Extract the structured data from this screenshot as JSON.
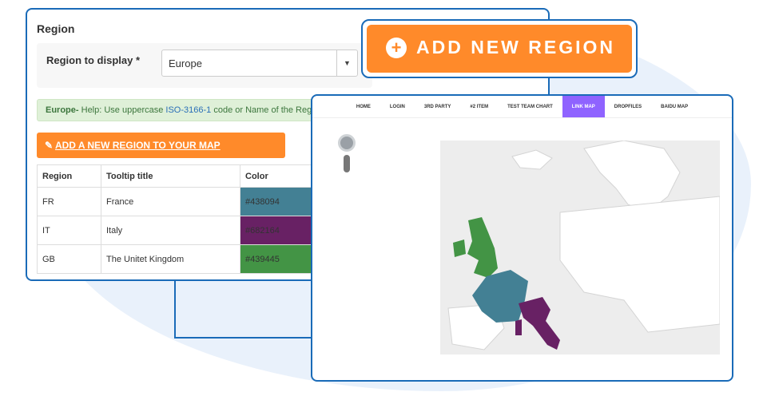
{
  "admin": {
    "title": "Region",
    "region_label": "Region to display *",
    "region_value": "Europe",
    "help_region": "Europe-",
    "help_text": " Help: Use uppercase ",
    "help_link": "ISO-3166-1",
    "help_tail": " code or Name of the Regio",
    "add_link": "ADD A NEW REGION TO YOUR MAP",
    "table": {
      "headers": [
        "Region",
        "Tooltip title",
        "Color"
      ],
      "rows": [
        {
          "region": "FR",
          "title": "France",
          "color": "#438094"
        },
        {
          "region": "IT",
          "title": "Italy",
          "color": "#682164"
        },
        {
          "region": "GB",
          "title": "The Unitet Kingdom",
          "color": "#439445"
        }
      ]
    }
  },
  "add_button": {
    "label": "ADD NEW REGION",
    "icon": "plus-circle-icon"
  },
  "map_nav": {
    "items": [
      "HOME",
      "LOGIN",
      "3RD PARTY",
      "#2 ITEM",
      "TEST TEAM CHART",
      "LINK MAP",
      "DROPFILES",
      "BAIDU MAP"
    ],
    "active_index": 5
  },
  "colors": {
    "accent_orange": "#ff8a2a",
    "frame_blue": "#1a6bb8",
    "france": "#438094",
    "italy": "#682164",
    "uk": "#439445",
    "active_nav": "#8f63ff"
  }
}
